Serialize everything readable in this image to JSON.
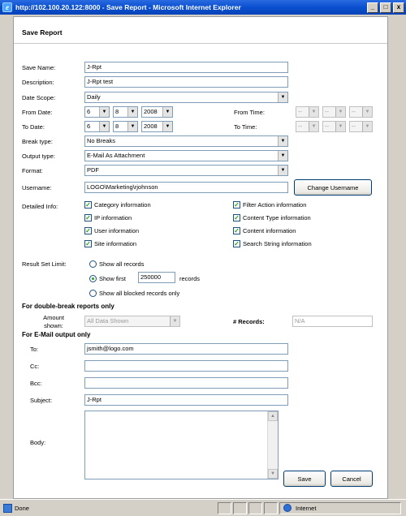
{
  "window": {
    "title": "http://102.100.20.122:8000 - Save Report - Microsoft Internet Explorer",
    "min_label": "_",
    "max_label": "□",
    "close_label": "x"
  },
  "dialog": {
    "title": "Save Report",
    "save_name": {
      "label": "Save Name:",
      "value": "J-Rpt"
    },
    "description": {
      "label": "Description:",
      "value": "J-Rpt test"
    },
    "date_scope": {
      "label": "Date Scope:",
      "value": "Daily"
    },
    "from_date": {
      "label": "From Date:",
      "month": "6",
      "day": "8",
      "year": "2008"
    },
    "to_date": {
      "label": "To Date:",
      "month": "6",
      "day": "8",
      "year": "2008"
    },
    "from_time": {
      "label": "From Time:",
      "h": "--",
      "m": "--",
      "s": "--"
    },
    "to_time": {
      "label": "To Time:",
      "h": "--",
      "m": "--",
      "s": "--"
    },
    "break_type": {
      "label": "Break type:",
      "value": "No Breaks"
    },
    "output_type": {
      "label": "Output type:",
      "value": "E-Mail As Attachment"
    },
    "format": {
      "label": "Format:",
      "value": "PDF"
    },
    "username": {
      "label": "Username:",
      "value": "LOGO\\Marketing\\rjohnson",
      "button": "Change Username"
    },
    "detailed_info": {
      "label": "Detailed Info:",
      "left": [
        {
          "label": "Category information",
          "checked": true
        },
        {
          "label": "IP information",
          "checked": true
        },
        {
          "label": "User information",
          "checked": true
        },
        {
          "label": "Site information",
          "checked": true
        }
      ],
      "right": [
        {
          "label": "Filter Action information",
          "checked": true
        },
        {
          "label": "Content Type information",
          "checked": true
        },
        {
          "label": "Content information",
          "checked": true
        },
        {
          "label": "Search String information",
          "checked": true
        }
      ]
    },
    "result_limit": {
      "label": "Result Set Limit:",
      "opt_all": "Show all records",
      "opt_first": "Show first",
      "first_value": "250000",
      "records_suffix": "records",
      "opt_blocked": "Show all blocked records only",
      "selected": "first"
    },
    "double_break": {
      "heading": "For double-break reports only",
      "amount_label": "Amount shown:",
      "amount_value": "All Data Shown",
      "records_label": "# Records:",
      "records_value": "N/A"
    },
    "email": {
      "heading": "For E-Mail output only",
      "to_label": "To:",
      "to_value": "jsmith@logo.com",
      "cc_label": "Cc:",
      "cc_value": "",
      "bcc_label": "Bcc:",
      "bcc_value": "",
      "subject_label": "Subject:",
      "subject_value": "J-Rpt",
      "body_label": "Body:",
      "body_value": ""
    },
    "save_button": "Save",
    "cancel_button": "Cancel"
  },
  "statusbar": {
    "status_text": "Done",
    "zone_text": "Internet"
  }
}
